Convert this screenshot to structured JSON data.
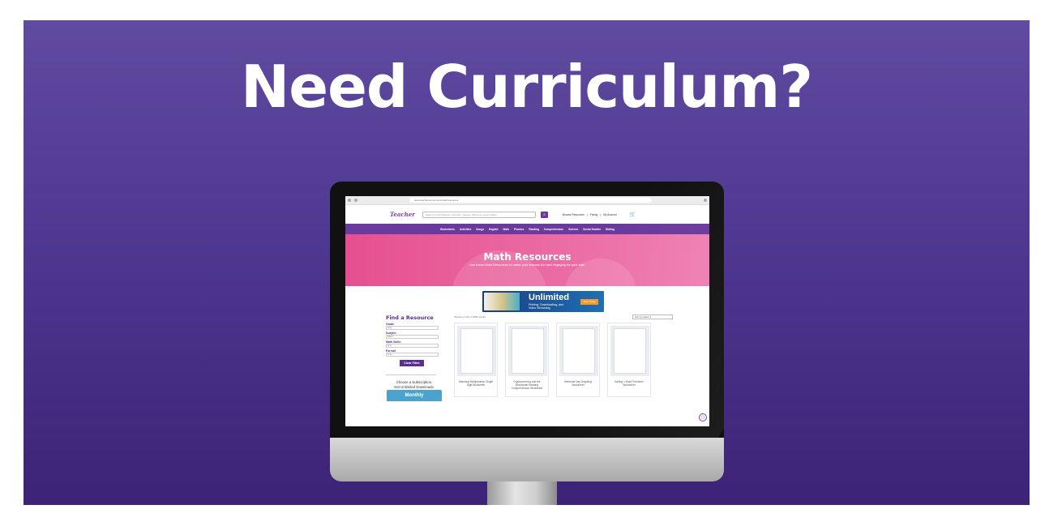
{
  "headline": "Need Curriculum?",
  "browser": {
    "url": "www.teachersource.com/math/resources"
  },
  "site": {
    "logo_text": "Teacher",
    "search_placeholder": "Search for Worksheets, Activities, Games, Videos & Lesson Plans",
    "top_links": [
      "Browse Resources",
      "|",
      "Pricing",
      "|",
      "My Account"
    ],
    "nav": [
      "Worksheets",
      "Activities",
      "Songs",
      "English",
      "Math",
      "Phonics",
      "Reading",
      "Comprehension",
      "Science",
      "Social Studies",
      "Writing"
    ]
  },
  "hero": {
    "title": "Math Resources",
    "subtitle": "Use these Math Resources to make your lessons fun and engaging for your kids."
  },
  "ad": {
    "title": "Unlimited",
    "subtitle": "Printing, Downloading, and Video Streaming.",
    "button": "Start Today"
  },
  "sidebar": {
    "title": "Find a Resource",
    "filters": [
      {
        "label": "Grade",
        "value": "Any"
      },
      {
        "label": "Subject",
        "value": "Math"
      },
      {
        "label": "Math Skills",
        "value": "Any"
      },
      {
        "label": "Format",
        "value": "Any"
      }
    ],
    "clear_button": "Clear Filter",
    "subscription_line1": "Choose a Subscription.",
    "subscription_line2": "Get Unlimited Downloads.",
    "monthly_label": "Monthly"
  },
  "grid": {
    "count_text": "Showing 1-20 of 1838 results",
    "sort_label": "Sort by latest ▾",
    "cards": [
      {
        "title": "Matching Multiplication Single Digit Worksheet"
      },
      {
        "title": "Cryptocurrency and the Blockchain Reading Comprehension Worksheet"
      },
      {
        "title": "Memorial Day Graphing Worksheet"
      },
      {
        "title": "Adding 1 Word Problems Worksheet"
      }
    ]
  },
  "colors": {
    "background_top": "#5f4ba0",
    "background_bottom": "#3d2377",
    "site_purple": "#6a3a9e",
    "hero_pink": "#e5508f"
  }
}
